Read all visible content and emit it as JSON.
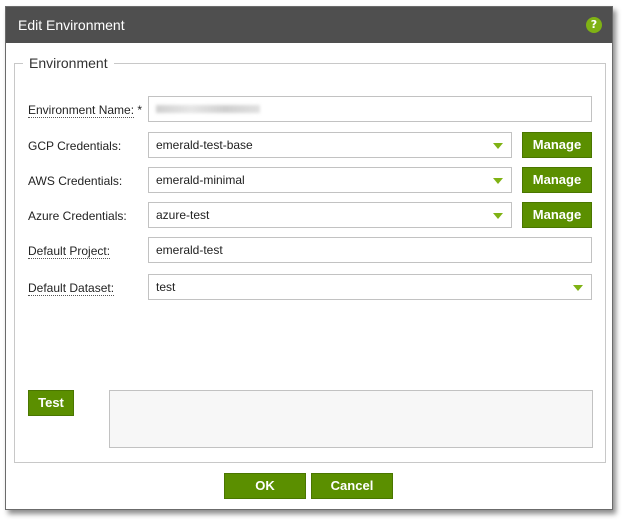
{
  "dialog": {
    "title": "Edit Environment",
    "help_glyph": "?"
  },
  "environment": {
    "legend": "Environment",
    "fields": {
      "name": {
        "label": "Environment Name:",
        "required_marker": "*",
        "value": ""
      },
      "gcp": {
        "label": "GCP Credentials:",
        "value": "emerald-test-base",
        "button": "Manage"
      },
      "aws": {
        "label": "AWS Credentials:",
        "value": "emerald-minimal",
        "button": "Manage"
      },
      "azure": {
        "label": "Azure Credentials:",
        "value": "azure-test",
        "button": "Manage"
      },
      "project": {
        "label": "Default Project:",
        "value": "emerald-test"
      },
      "dataset": {
        "label": "Default Dataset:",
        "value": "test"
      }
    },
    "test_button": "Test",
    "test_output": ""
  },
  "footer": {
    "ok": "OK",
    "cancel": "Cancel"
  },
  "colors": {
    "titlebar": "#4f4f4f",
    "button_green": "#5b8f00",
    "accent_green": "#7fb214"
  }
}
